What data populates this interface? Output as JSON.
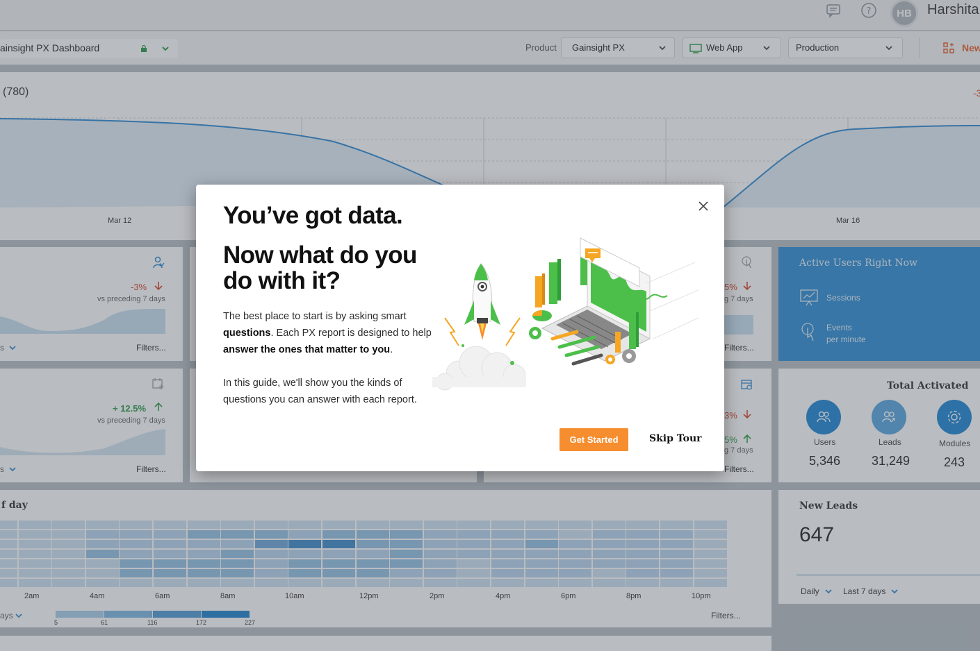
{
  "header": {
    "avatar_initials": "HB",
    "user_name": "Harshita"
  },
  "toolbar": {
    "dashboard_name": "ainsight PX Dashboard",
    "product_label": "Product",
    "product_value": "Gainsight PX",
    "app_value": "Web App",
    "env_value": "Production",
    "new_label": "New"
  },
  "top_chart": {
    "count_label": "(780)",
    "delta_partial": "-3",
    "x_labels": [
      "Mar 12",
      "Mar 16"
    ]
  },
  "card_a": {
    "delta": "-3%",
    "compare": "vs preceding 7 days",
    "filters": "Filters..."
  },
  "card_b": {
    "delta": "+ 12.5%",
    "compare": "vs preceding 7 days",
    "filters": "Filters..."
  },
  "card_c": {
    "delta": "5%",
    "compare": "g 7 days",
    "filters": "Filters..."
  },
  "card_d": {
    "delta1": "3%",
    "delta2": "5%",
    "compare": "g 7 days",
    "filters": "Filters..."
  },
  "active_users": {
    "title": "Active Users Right Now",
    "sessions_label": "Sessions",
    "events_label_1": "Events",
    "events_label_2": "per minute"
  },
  "total_activated": {
    "title": "Total Activated",
    "items": [
      {
        "label": "Users",
        "value": "5,346"
      },
      {
        "label": "Leads",
        "value": "31,249"
      },
      {
        "label": "Modules",
        "value": "243"
      }
    ]
  },
  "heatmap": {
    "title": "f day",
    "x_labels": [
      "2am",
      "4am",
      "6am",
      "8am",
      "10am",
      "12pm",
      "2pm",
      "4pm",
      "6pm",
      "8pm",
      "10pm"
    ],
    "legend_values": [
      "5",
      "61",
      "116",
      "172",
      "227"
    ],
    "period_partial": "ays",
    "filters": "Filters..."
  },
  "new_leads": {
    "title": "New Leads",
    "value": "647",
    "interval": "Daily",
    "range": "Last 7 days"
  },
  "modal": {
    "title": "You’ve got data.",
    "subtitle": "Now what do you do with it?",
    "p1_a": "The best place to start is by asking smart ",
    "p1_b": "questions",
    "p1_c": ". Each PX report is designed to help ",
    "p1_d": "answer the ones that matter to you",
    "p1_e": ".",
    "p2": "In this guide, we'll show you the kinds of questions you can answer with each report.",
    "primary_button": "Get Started",
    "secondary_button": "Skip Tour"
  },
  "colors": {
    "accent_orange": "#f68d2e",
    "brand_blue": "#1e87d6",
    "delta_red": "#d9452c",
    "delta_green": "#2c9c4b"
  }
}
